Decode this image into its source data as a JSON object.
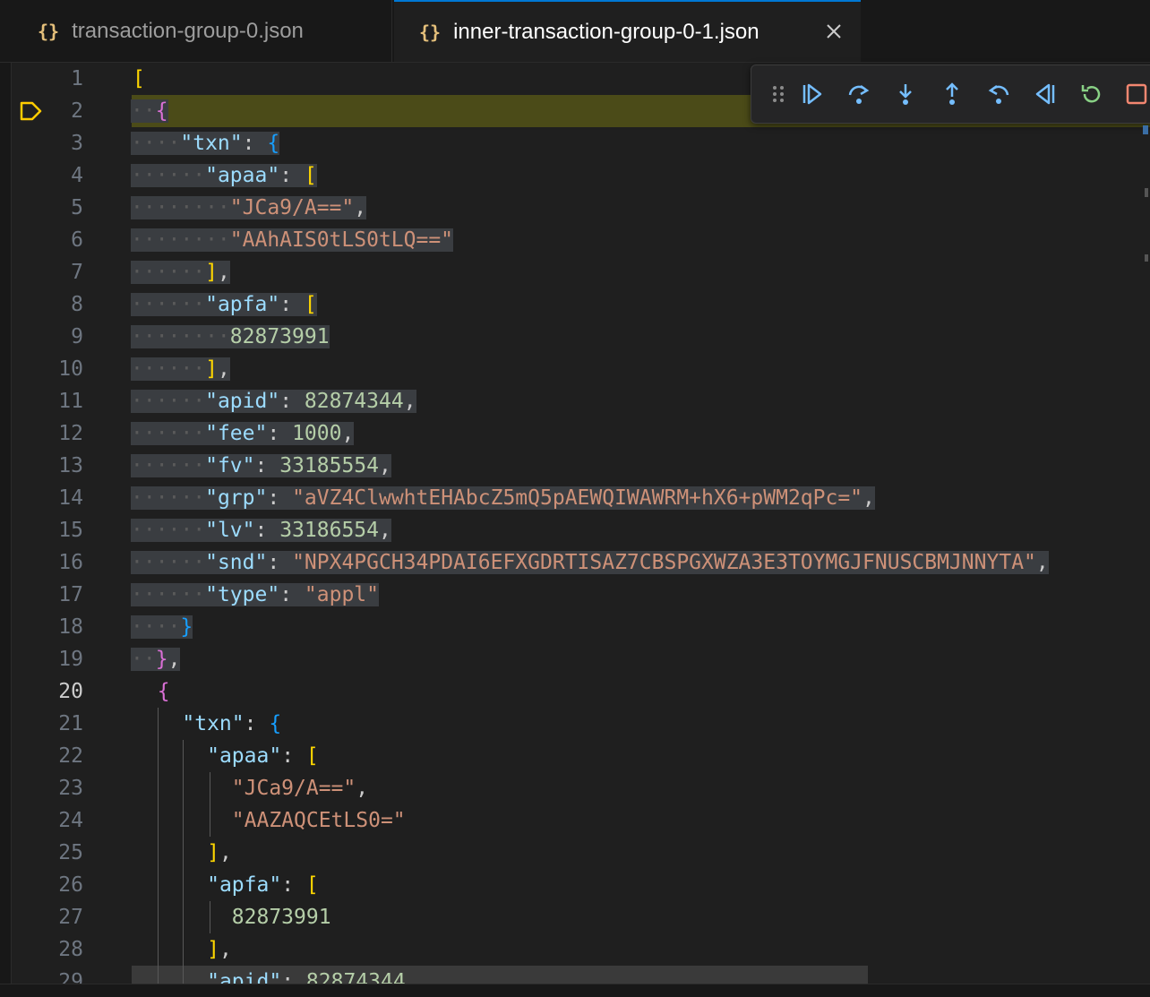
{
  "tabs": [
    {
      "icon": "{}",
      "label": "transaction-group-0.json",
      "active": false
    },
    {
      "icon": "{}",
      "label": "inner-transaction-group-0-1.json",
      "active": true
    }
  ],
  "debug_toolbar": {
    "buttons": [
      "drag-handle",
      "continue",
      "step-over",
      "step-into",
      "step-out",
      "step-back",
      "reverse-continue",
      "restart",
      "stop"
    ]
  },
  "editor": {
    "current_line": 2,
    "cursor_line": 20,
    "lines": [
      {
        "n": "1",
        "t": "["
      },
      {
        "n": "2",
        "t": "  {"
      },
      {
        "n": "3",
        "t": "    \"txn\": {"
      },
      {
        "n": "4",
        "t": "      \"apaa\": ["
      },
      {
        "n": "5",
        "t": "        \"JCa9/A==\","
      },
      {
        "n": "6",
        "t": "        \"AAhAIS0tLS0tLQ==\""
      },
      {
        "n": "7",
        "t": "      ],"
      },
      {
        "n": "8",
        "t": "      \"apfa\": ["
      },
      {
        "n": "9",
        "t": "        82873991"
      },
      {
        "n": "10",
        "t": "      ],"
      },
      {
        "n": "11",
        "t": "      \"apid\": 82874344,"
      },
      {
        "n": "12",
        "t": "      \"fee\": 1000,"
      },
      {
        "n": "13",
        "t": "      \"fv\": 33185554,"
      },
      {
        "n": "14",
        "t": "      \"grp\": \"aVZ4ClwwhtEHAbcZ5mQ5pAEWQIWAWRM+hX6+pWM2qPc=\","
      },
      {
        "n": "15",
        "t": "      \"lv\": 33186554,"
      },
      {
        "n": "16",
        "t": "      \"snd\": \"NPX4PGCH34PDAI6EFXGDRTISAZ7CBSPGXWZA3E3TOYMGJFNUSCBMJNNYTA\","
      },
      {
        "n": "17",
        "t": "      \"type\": \"appl\""
      },
      {
        "n": "18",
        "t": "    }"
      },
      {
        "n": "19",
        "t": "  },"
      },
      {
        "n": "20",
        "t": "  {"
      },
      {
        "n": "21",
        "t": "    \"txn\": {"
      },
      {
        "n": "22",
        "t": "      \"apaa\": ["
      },
      {
        "n": "23",
        "t": "        \"JCa9/A==\","
      },
      {
        "n": "24",
        "t": "        \"AAZAQCEtLS0=\""
      },
      {
        "n": "25",
        "t": "      ],"
      },
      {
        "n": "26",
        "t": "      \"apfa\": ["
      },
      {
        "n": "27",
        "t": "        82873991"
      },
      {
        "n": "28",
        "t": "      ],"
      },
      {
        "n": "29",
        "t": "      \"apid\": 82874344"
      }
    ]
  },
  "colors": {
    "key": "#9cdcfe",
    "string": "#ce9178",
    "number": "#b5cea8",
    "bracket_level1": "#ffd700",
    "bracket_level2": "#da70d6",
    "bracket_level3": "#179fff",
    "selection": "#3a3d41",
    "stopped_line": "#4b4b18",
    "active_tab_border": "#0078d4"
  }
}
